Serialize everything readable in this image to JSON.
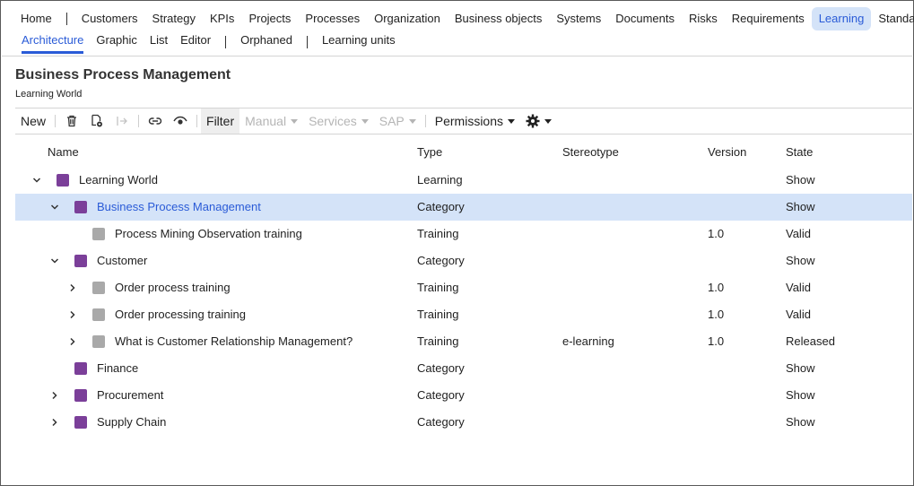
{
  "nav": {
    "items": [
      {
        "label": "Home",
        "active": false
      },
      {
        "label": "Customers",
        "active": false
      },
      {
        "label": "Strategy",
        "active": false
      },
      {
        "label": "KPIs",
        "active": false
      },
      {
        "label": "Projects",
        "active": false
      },
      {
        "label": "Processes",
        "active": false
      },
      {
        "label": "Organization",
        "active": false
      },
      {
        "label": "Business objects",
        "active": false
      },
      {
        "label": "Systems",
        "active": false
      },
      {
        "label": "Documents",
        "active": false
      },
      {
        "label": "Risks",
        "active": false
      },
      {
        "label": "Requirements",
        "active": false
      },
      {
        "label": "Learning",
        "active": true
      },
      {
        "label": "Standards",
        "active": false
      }
    ]
  },
  "subnav": {
    "items": [
      "Architecture",
      "Graphic",
      "List",
      "Editor",
      "Orphaned",
      "Learning units"
    ],
    "active": "Architecture"
  },
  "page": {
    "title": "Business Process Management",
    "subtitle": "Learning World"
  },
  "toolbar": {
    "new_label": "New",
    "filter_label": "Filter",
    "manual_label": "Manual",
    "services_label": "Services",
    "sap_label": "SAP",
    "permissions_label": "Permissions",
    "icons": [
      "trash-icon",
      "copy-document-icon",
      "move-icon",
      "link-icon",
      "eye-icon",
      "gear-icon"
    ]
  },
  "table": {
    "headers": {
      "name": "Name",
      "type": "Type",
      "stereotype": "Stereotype",
      "version": "Version",
      "state": "State"
    },
    "rows": [
      {
        "level": 0,
        "expander": "open",
        "color": "purple",
        "name": "Learning World",
        "type": "Learning",
        "stereotype": "",
        "version": "",
        "state": "Show",
        "selected": false
      },
      {
        "level": 1,
        "expander": "open",
        "color": "purple",
        "name": "Business Process Management",
        "type": "Category",
        "stereotype": "",
        "version": "",
        "state": "Show",
        "selected": true
      },
      {
        "level": 2,
        "expander": "none",
        "color": "gray",
        "name": "Process Mining Observation training",
        "type": "Training",
        "stereotype": "",
        "version": "1.0",
        "state": "Valid",
        "selected": false
      },
      {
        "level": 1,
        "expander": "open",
        "color": "purple",
        "name": "Customer",
        "type": "Category",
        "stereotype": "",
        "version": "",
        "state": "Show",
        "selected": false
      },
      {
        "level": 2,
        "expander": "closed",
        "color": "gray",
        "name": "Order process training",
        "type": "Training",
        "stereotype": "",
        "version": "1.0",
        "state": "Valid",
        "selected": false
      },
      {
        "level": 2,
        "expander": "closed",
        "color": "gray",
        "name": "Order processing training",
        "type": "Training",
        "stereotype": "",
        "version": "1.0",
        "state": "Valid",
        "selected": false
      },
      {
        "level": 2,
        "expander": "closed",
        "color": "gray",
        "name": "What is Customer Relationship Management?",
        "type": "Training",
        "stereotype": "e-learning",
        "version": "1.0",
        "state": "Released",
        "selected": false
      },
      {
        "level": 1,
        "expander": "none",
        "color": "purple",
        "name": "Finance",
        "type": "Category",
        "stereotype": "",
        "version": "",
        "state": "Show",
        "selected": false
      },
      {
        "level": 1,
        "expander": "closed",
        "color": "purple",
        "name": "Procurement",
        "type": "Category",
        "stereotype": "",
        "version": "",
        "state": "Show",
        "selected": false
      },
      {
        "level": 1,
        "expander": "closed",
        "color": "purple",
        "name": "Supply Chain",
        "type": "Category",
        "stereotype": "",
        "version": "",
        "state": "Show",
        "selected": false
      }
    ]
  },
  "colors": {
    "accent": "#2a5bd7",
    "selected_bg": "#d4e3f8",
    "category": "#7b3f99",
    "training": "#a9a9a9"
  }
}
